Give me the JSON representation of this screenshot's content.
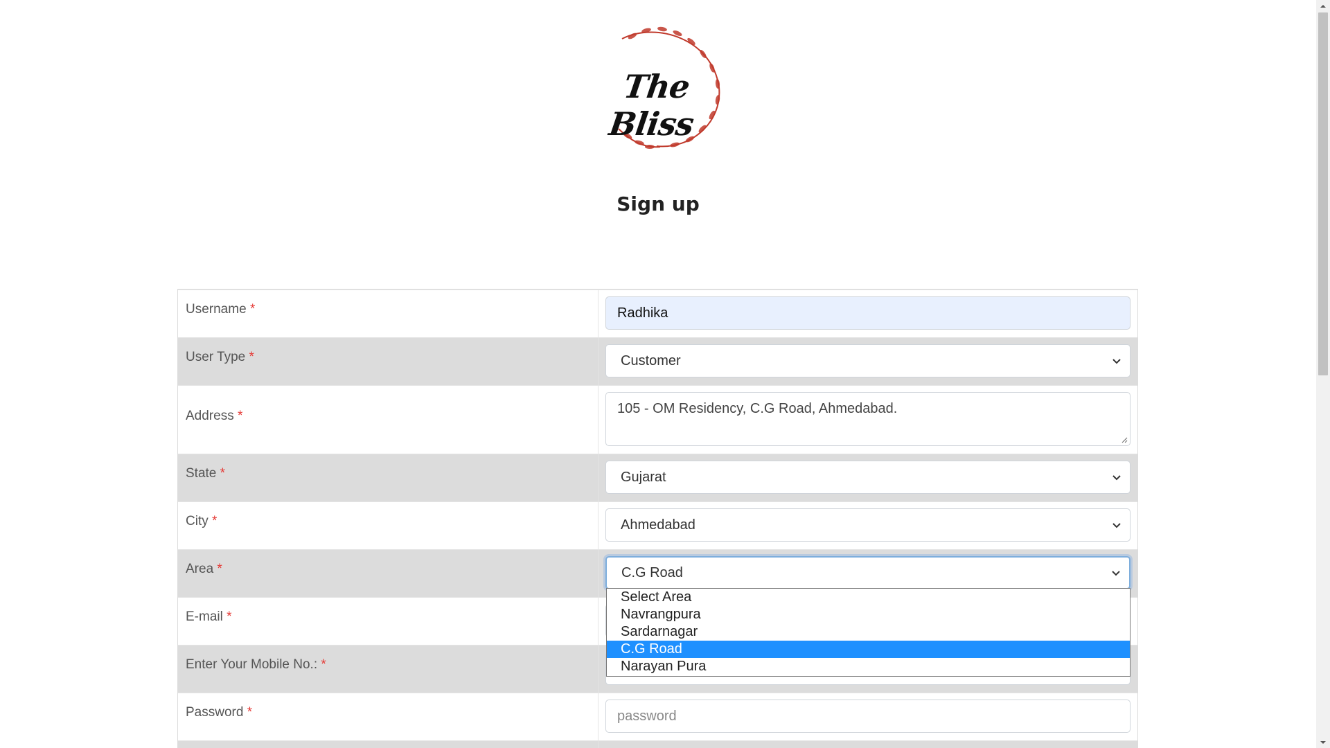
{
  "logo": {
    "text": "The Bliss",
    "accent_color": "#c0392b"
  },
  "page_title": "Sign up",
  "required_mark": "*",
  "form": {
    "username": {
      "label": "Username",
      "value": "Radhika"
    },
    "user_type": {
      "label": "User Type",
      "value": "Customer"
    },
    "address": {
      "label": "Address",
      "value": "105 - OM Residency, C.G Road, Ahmedabad."
    },
    "state": {
      "label": "State",
      "value": "Gujarat"
    },
    "city": {
      "label": "City",
      "value": "Ahmedabad"
    },
    "area": {
      "label": "Area",
      "value": "C.G Road",
      "options": [
        "Select Area",
        "Navrangpura",
        "Sardarnagar",
        "C.G Road",
        "Narayan Pura"
      ],
      "highlighted_option": "C.G Road"
    },
    "email": {
      "label": "E-mail"
    },
    "mobile": {
      "label": "Enter Your Mobile No.:"
    },
    "password": {
      "label": "Password",
      "placeholder": "password"
    }
  },
  "colors": {
    "required": "#e53935",
    "highlight": "#1e90ff",
    "autofill": "#e8f0fe",
    "alt_row": "#dcdcdc"
  }
}
